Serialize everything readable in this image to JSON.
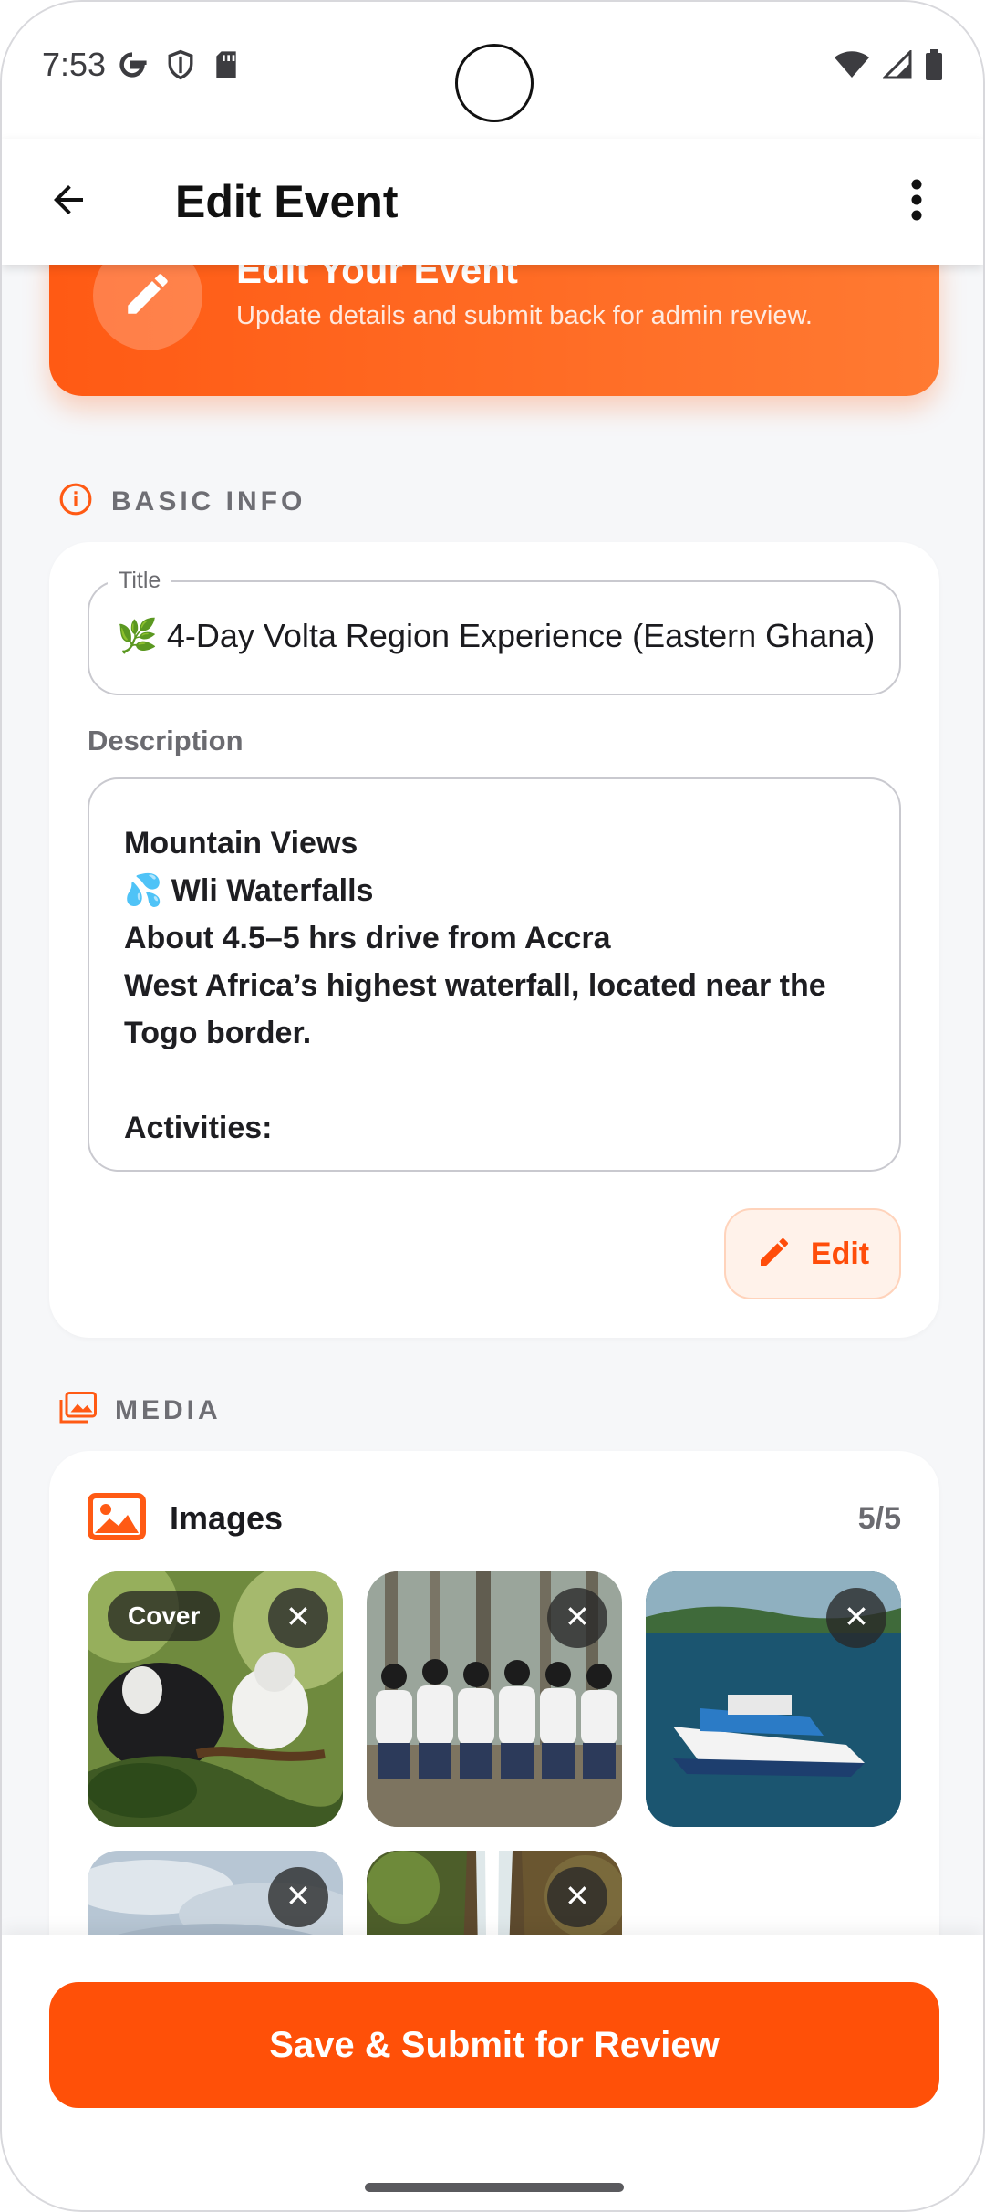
{
  "status_bar": {
    "time": "7:53",
    "left_icons": [
      "google-g-icon",
      "shield-icon",
      "sd-card-icon"
    ],
    "right_icons": [
      "wifi-icon",
      "cell-signal-icon",
      "battery-icon"
    ]
  },
  "app_bar": {
    "title": "Edit Event",
    "back_icon": "arrow-back-icon",
    "menu_icon": "more-vertical-icon"
  },
  "hero": {
    "title": "Edit Your Event",
    "subtitle": "Update details and submit back for admin review.",
    "icon": "pencil-icon"
  },
  "basic_info": {
    "section_label": "BASIC INFO",
    "title_label": "Title",
    "title_value": "🌿 4-Day Volta Region Experience (Eastern Ghana)",
    "description_label": "Description",
    "description_lines": [
      "Mountain Views",
      "💦 Wli Waterfalls",
      "About 4.5–5 hrs drive from Accra",
      "West Africa’s highest waterfall, located near the",
      "Togo border.",
      "",
      "Activities:"
    ],
    "edit_label": "Edit"
  },
  "media": {
    "section_label": "MEDIA",
    "images_title": "Images",
    "images_count": "5/5",
    "cover_badge": "Cover",
    "images": [
      {
        "subject": "monkeys"
      },
      {
        "subject": "group-in-forest"
      },
      {
        "subject": "boat-on-lake"
      },
      {
        "subject": "cloudy-sky"
      },
      {
        "subject": "waterfall"
      }
    ]
  },
  "colors": {
    "accent": "#ff5008",
    "hero_gradient_start": "#ff5a14",
    "hero_gradient_end": "#ff7a32",
    "section_icon": "#ff5a14"
  },
  "footer": {
    "submit_label": "Save & Submit for Review"
  }
}
